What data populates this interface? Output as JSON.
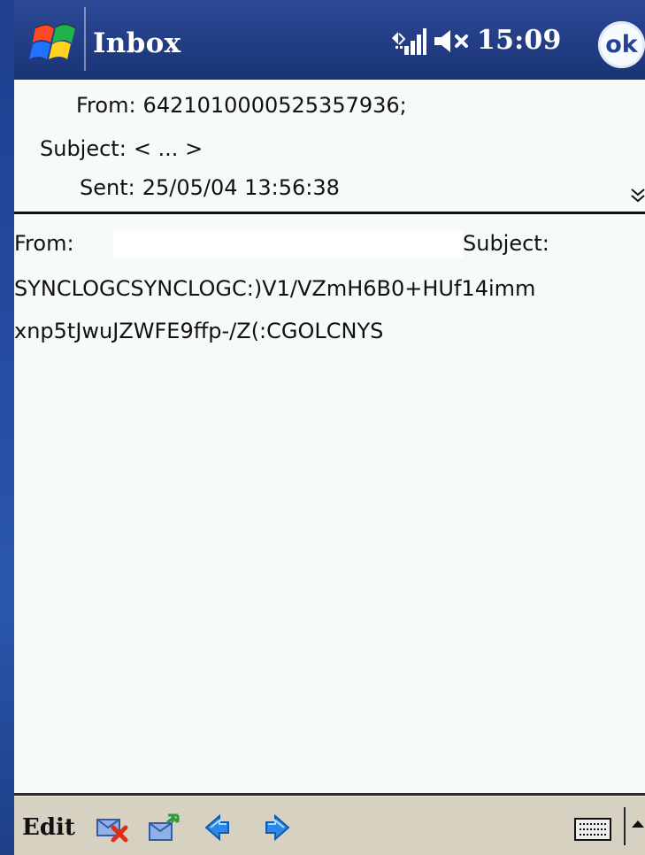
{
  "window": {
    "title": "Inbox",
    "time": "15:09",
    "ok_label": "ok",
    "icons": [
      "windows-start-icon",
      "signal-icon",
      "volume-icon"
    ]
  },
  "message_header": {
    "from_label": "From:",
    "from_value": "6421010000525357936;",
    "subject_label": "Subject:",
    "subject_value": "< ... >",
    "sent_label": "Sent:",
    "sent_value": "25/05/04 13:56:38"
  },
  "message_body": {
    "from_label": "From:",
    "subject_label": "Subject:",
    "line1": "SYNCLOGCSYNCLOGC:)V1/VZmH6B0+HUf14imm",
    "line2": "xnp5tJwuJZWFE9ffp-/Z(:CGOLCNYS"
  },
  "toolbar": {
    "edit_label": "Edit",
    "icons": [
      "delete-message-icon",
      "reply-message-icon",
      "previous-message-icon",
      "next-message-icon",
      "keyboard-icon",
      "input-selector-arrow-icon"
    ]
  },
  "colors": {
    "title_bar": "#223d84",
    "content_bg": "#f7fbf8",
    "toolbar_bg": "#d7d1c2",
    "accent_blue": "#2a5fbf"
  }
}
